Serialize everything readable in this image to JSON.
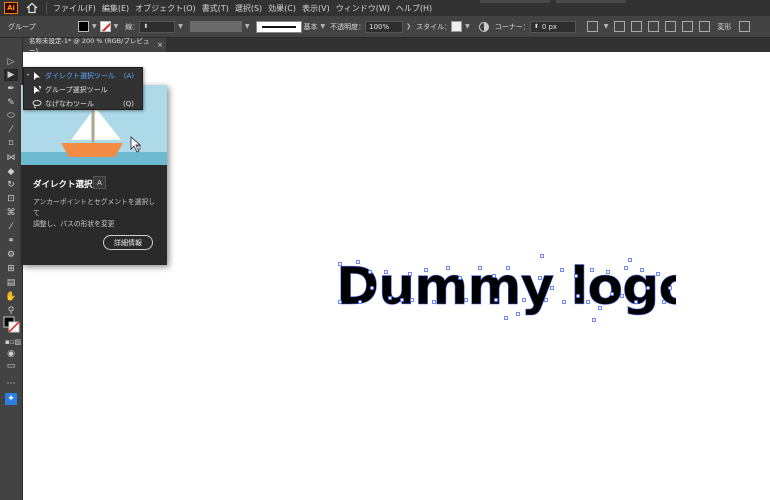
{
  "app": {
    "logo": "Ai"
  },
  "menu": {
    "items": [
      "ファイル(F)",
      "編集(E)",
      "オブジェクト(O)",
      "書式(T)",
      "選択(S)",
      "効果(C)",
      "表示(V)",
      "ウィンドウ(W)",
      "ヘルプ(H)"
    ]
  },
  "controlbar": {
    "selection": "グループ",
    "stroke_label": "線：",
    "stroke_style": "基本",
    "opacity_label": "不透明度：",
    "opacity_value": "100%",
    "style_label": "スタイル：",
    "corner_label": "コーナー：",
    "corner_value": "0 px",
    "transform_label": "変形"
  },
  "document": {
    "tab_title": "名称未設定-1* @ 200 % (RGB/プレビュー)",
    "close": "×"
  },
  "flyout": {
    "items": [
      {
        "label": "ダイレクト選択ツール",
        "shortcut": "(A)",
        "selected": true,
        "icon": "direct-selection-icon"
      },
      {
        "label": "グループ選択ツール",
        "shortcut": "",
        "selected": false,
        "icon": "group-selection-icon"
      },
      {
        "label": "なげなわツール",
        "shortcut": "(Q)",
        "selected": false,
        "icon": "lasso-icon"
      }
    ]
  },
  "tooltip": {
    "title": "ダイレクト選択",
    "shortcut": "A",
    "desc_line1": "アンカーポイントとセグメントを選択して",
    "desc_line2": "調整し、パスの形状を変更",
    "button": "詳細情報"
  },
  "canvas": {
    "logo_text": "Dummy logo"
  },
  "colors": {
    "ui_dark": "#323232",
    "ui_panel": "#434343",
    "accent_blue": "#2a7de1",
    "anchor_blue": "#4a6cf7",
    "sky": "#aed9e8",
    "water": "#6db9cf",
    "boat": "#f28c45"
  }
}
